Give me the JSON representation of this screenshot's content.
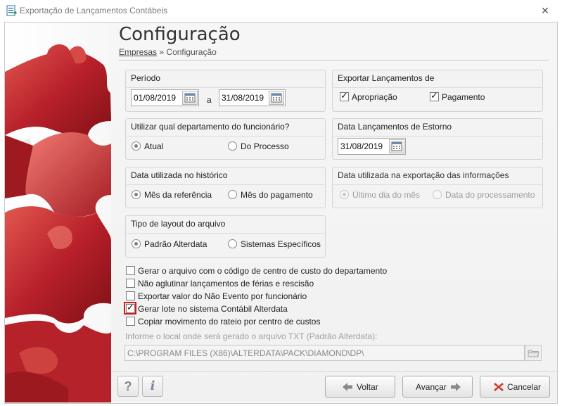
{
  "window": {
    "title": "Exportação de Lançamentos Contábeis",
    "close_glyph": "✕"
  },
  "header": {
    "title": "Configuração",
    "breadcrumb": {
      "link": "Empresas",
      "separator": "»",
      "current": "Configuração"
    }
  },
  "periodo": {
    "title": "Período",
    "start": "01/08/2019",
    "between": "a",
    "end": "31/08/2019"
  },
  "exportar": {
    "title": "Exportar Lançamentos de",
    "apropriacao": {
      "label": "Apropriação",
      "checked": true
    },
    "pagamento": {
      "label": "Pagamento",
      "checked": true
    }
  },
  "departamento": {
    "title": "Utilizar qual departamento do funcionário?",
    "options": [
      "Atual",
      "Do Processo"
    ],
    "selected": "Atual"
  },
  "estorno": {
    "title": "Data Lançamentos de Estorno",
    "date": "31/08/2019"
  },
  "historico": {
    "title": "Data utilizada no histórico",
    "options": [
      "Mês da referência",
      "Mês do pagamento"
    ],
    "selected": "Mês da referência"
  },
  "exportacao_info": {
    "title": "Data utilizada na exportação das informações",
    "options": [
      "Último dia do mês",
      "Data do processamento"
    ],
    "selected": "Último dia do mês",
    "disabled": true
  },
  "layout": {
    "title": "Tipo de layout do arquivo",
    "options": [
      "Padrão Alterdata",
      "Sistemas Específicos"
    ],
    "selected": "Padrão Alterdata"
  },
  "options": [
    {
      "label": "Gerar o arquivo com o código de centro de custo do departamento",
      "checked": false
    },
    {
      "label": "Não aglutinar lançamentos de férias e rescisão",
      "checked": false
    },
    {
      "label": "Exportar valor do Não Evento por funcionário",
      "checked": false
    },
    {
      "label": "Gerar lote no sistema Contábil Alterdata",
      "checked": true
    },
    {
      "label": "Copiar movimento do rateio por centro de custos",
      "checked": false
    }
  ],
  "path": {
    "label": "Informe o local onde será gerado o arquivo TXT (Padrão Alterdata):",
    "value": "C:\\PROGRAM FILES (X86)\\ALTERDATA\\PACK\\DIAMOND\\DP\\"
  },
  "footer": {
    "help": "?",
    "info": "i",
    "back": "Voltar",
    "next": "Avançar",
    "cancel": "Cancelar"
  },
  "colors": {
    "accent_red": "#d21d1d",
    "puzzle_red": "#c0282a",
    "arrow_gray": "#8a8a8a"
  },
  "icons": {
    "window": "export-app-icon",
    "close": "close-icon",
    "calendar": "calendar-icon",
    "folder": "folder-icon",
    "back": "arrow-left-icon",
    "next": "arrow-right-icon",
    "cancel": "x-icon"
  }
}
